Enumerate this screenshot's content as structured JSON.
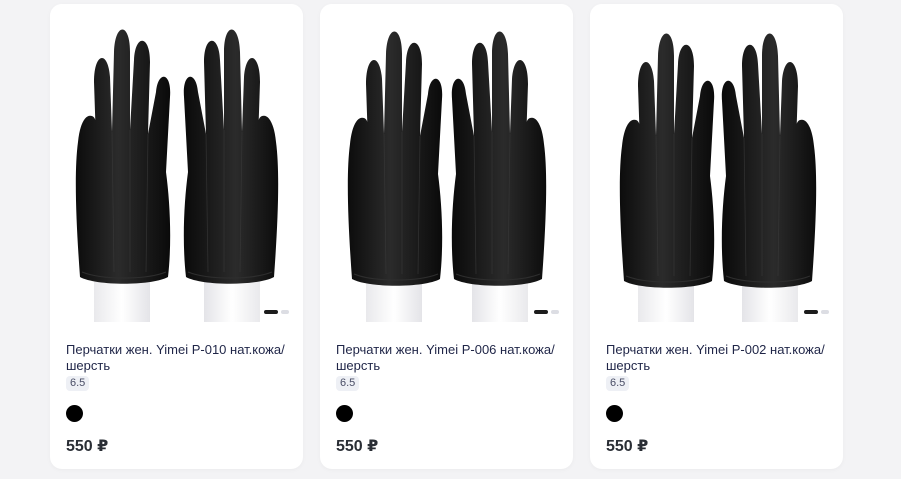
{
  "products": [
    {
      "title": "Перчатки жен. Yimei P-010 нат.кожа/шерсть",
      "size": "6.5",
      "price": "550 ₽",
      "color": "#000000"
    },
    {
      "title": "Перчатки жен. Yimei P-006 нат.кожа/шерсть",
      "size": "6.5",
      "price": "550 ₽",
      "color": "#000000"
    },
    {
      "title": "Перчатки жен. Yimei P-002 нат.кожа/шерсть",
      "size": "6.5",
      "price": "550 ₽",
      "color": "#000000"
    }
  ],
  "image_slider": {
    "slides": 2,
    "active": 1
  }
}
